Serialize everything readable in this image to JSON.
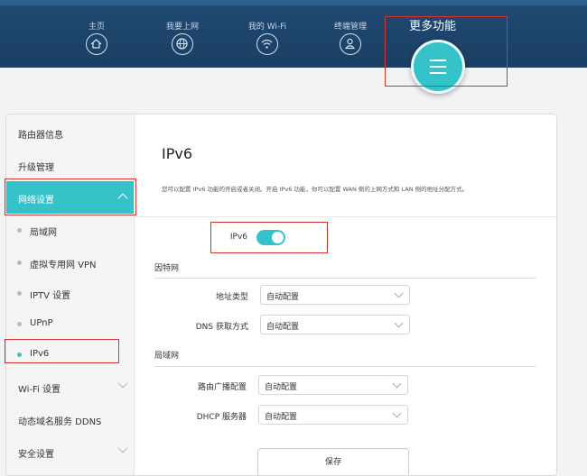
{
  "nav": {
    "home": "主页",
    "internet": "我要上网",
    "wifi": "我的 Wi-Fi",
    "devices": "终端管理",
    "more": "更多功能"
  },
  "sidebar": {
    "items": [
      {
        "label": "路由器信息"
      },
      {
        "label": "升级管理"
      },
      {
        "label": "网络设置"
      },
      {
        "label": "局域网"
      },
      {
        "label": "虚拟专用网 VPN"
      },
      {
        "label": "IPTV 设置"
      },
      {
        "label": "UPnP"
      },
      {
        "label": "IPv6"
      },
      {
        "label": "Wi-Fi 设置"
      },
      {
        "label": "动态域名服务 DDNS"
      },
      {
        "label": "安全设置"
      }
    ]
  },
  "main": {
    "title": "IPv6",
    "description": "您可以配置 IPv6 功能的开启或者关闭。开启 IPv6 功能，你可以配置 WAN 侧的上网方式和 LAN 侧的地址分配方式。",
    "toggle_label": "IPv6",
    "toggle_on": true,
    "internet_section": "因特网",
    "address_type_label": "地址类型",
    "address_type_value": "自动配置",
    "dns_label": "DNS 获取方式",
    "dns_value": "自动配置",
    "lan_section": "局域网",
    "route_broadcast_label": "路由广播配置",
    "route_broadcast_value": "自动配置",
    "dhcp_label": "DHCP 服务器",
    "dhcp_value": "自动配置",
    "save_label": "保存"
  },
  "colors": {
    "accent": "#35c2c9",
    "header": "#1f4a73",
    "highlight_box": "#d9332f"
  }
}
